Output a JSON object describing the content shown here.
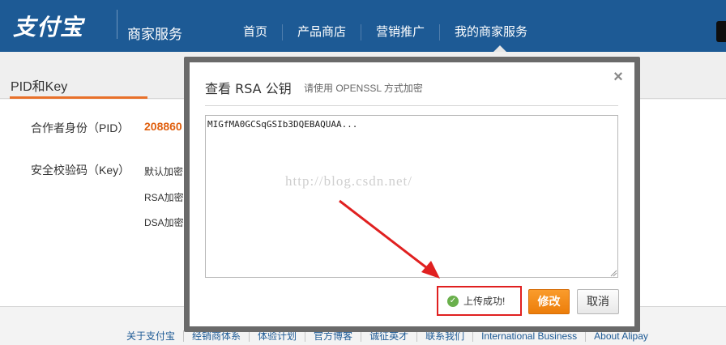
{
  "header": {
    "logo": "支付宝",
    "service_title": "商家服务",
    "nav": [
      {
        "label": "首页"
      },
      {
        "label": "产品商店"
      },
      {
        "label": "营销推广"
      },
      {
        "label": "我的商家服务"
      }
    ]
  },
  "page": {
    "tab_label": "PID和Key",
    "pid_label": "合作者身份（PID）",
    "pid_value": "208860",
    "key_label": "安全校验码（Key）",
    "key_rows": [
      "默认加密：",
      "RSA加密：",
      "DSA加密："
    ]
  },
  "footer": {
    "links": [
      "关于支付宝",
      "经销商体系",
      "体验计划",
      "官方博客",
      "诚征英才",
      "联系我们",
      "International Business",
      "About Alipay"
    ]
  },
  "modal": {
    "title": "查看 RSA 公钥",
    "subtitle": "请使用 OPENSSL 方式加密",
    "close_label": "×",
    "key_value": "MIGfMA0GCSqGSIb3DQEBAQUAA...",
    "watermark": "http://blog.csdn.net/",
    "success_message": "上传成功!",
    "edit_button": "修改",
    "cancel_button": "取消"
  },
  "colors": {
    "header_bg": "#1d5a95",
    "accent": "#e8702a",
    "highlight_red": "#e02020",
    "success_green": "#6ab04c"
  }
}
